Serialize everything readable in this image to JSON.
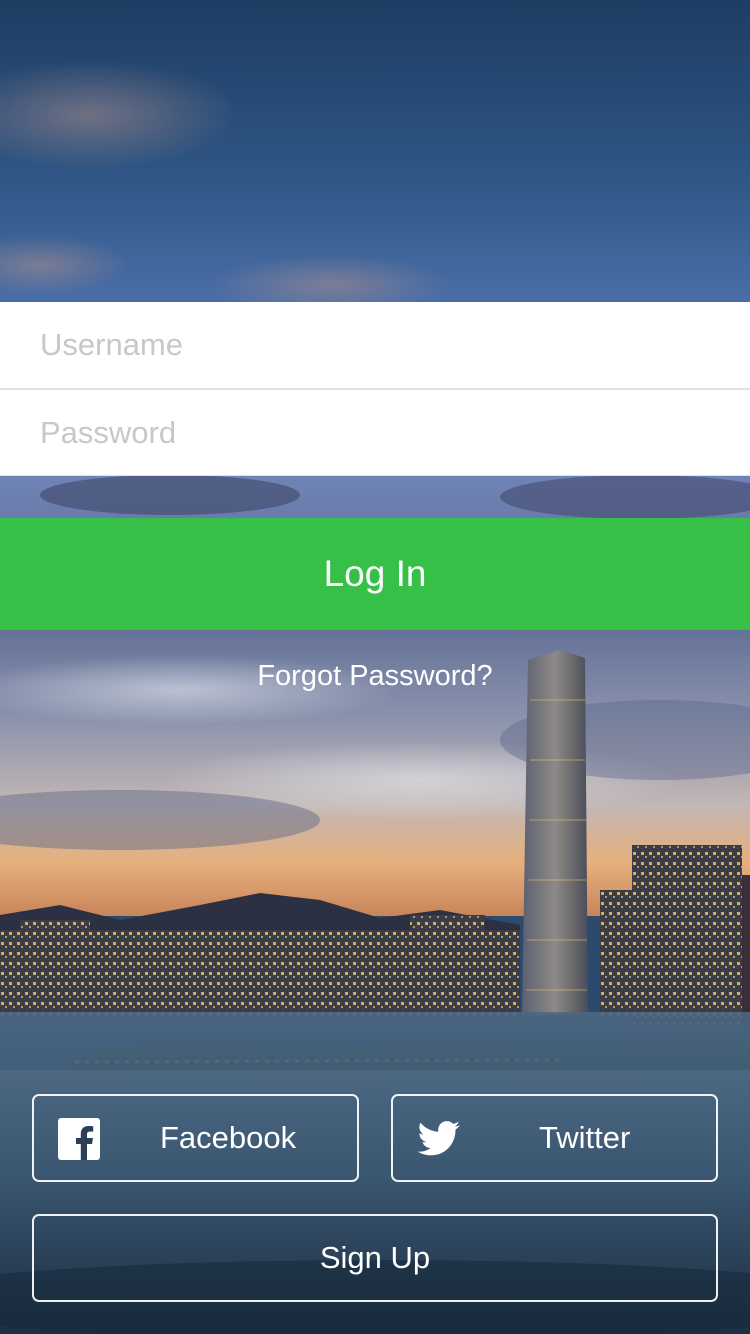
{
  "login_form": {
    "username_placeholder": "Username",
    "password_placeholder": "Password",
    "login_label": "Log In",
    "forgot_password_label": "Forgot Password?"
  },
  "social": {
    "facebook_label": "Facebook",
    "facebook_icon": "facebook-icon",
    "twitter_label": "Twitter",
    "twitter_icon": "twitter-icon"
  },
  "signup_label": "Sign Up",
  "colors": {
    "login_button": "#36c048",
    "field_background": "#ffffff",
    "placeholder_text": "#c7c7cc",
    "button_text": "#ffffff"
  }
}
